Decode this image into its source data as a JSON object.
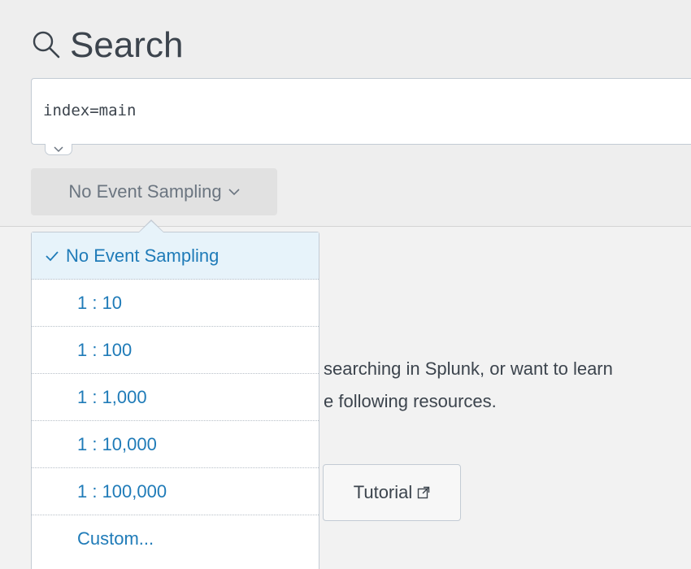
{
  "header": {
    "title": "Search",
    "icon": "search-icon"
  },
  "search": {
    "query": "index=main"
  },
  "sampling": {
    "button_label": "No Event Sampling",
    "options": [
      {
        "label": "No Event Sampling",
        "selected": true
      },
      {
        "label": "1 : 10"
      },
      {
        "label": "1 : 100"
      },
      {
        "label": "1 : 1,000"
      },
      {
        "label": "1 : 10,000"
      },
      {
        "label": "1 : 100,000"
      },
      {
        "label": "Custom..."
      }
    ]
  },
  "help": {
    "line1": "searching in Splunk, or want to learn",
    "line2": "e following resources.",
    "tutorial_label": "Tutorial"
  },
  "colors": {
    "accent": "#1f7bb8",
    "selected_bg": "#e7f3fa",
    "panel_bg": "#eeeeee"
  }
}
